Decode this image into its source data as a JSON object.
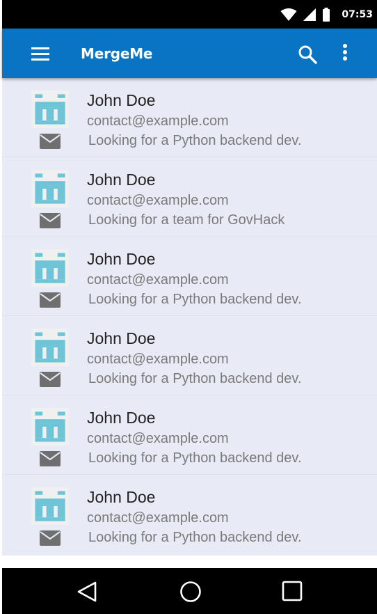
{
  "status_bar": {
    "time": "07:53",
    "icons": [
      "wifi-icon",
      "cellular-signal-icon",
      "battery-icon"
    ]
  },
  "app_bar": {
    "title": "MergeMe",
    "color": "#0a74c4",
    "icons": [
      "menu-icon",
      "search-icon",
      "more-vert-icon"
    ]
  },
  "list": {
    "background": "#e8eaf6",
    "items": [
      {
        "name": "John Doe",
        "email": "contact@example.com",
        "description": "Looking for a Python backend dev."
      },
      {
        "name": "John Doe",
        "email": "contact@example.com",
        "description": "Looking for a team for GovHack"
      },
      {
        "name": "John Doe",
        "email": "contact@example.com",
        "description": "Looking for a Python backend dev."
      },
      {
        "name": "John Doe",
        "email": "contact@example.com",
        "description": "Looking for a Python backend dev."
      },
      {
        "name": "John Doe",
        "email": "contact@example.com",
        "description": "Looking for a Python backend dev."
      },
      {
        "name": "John Doe",
        "email": "contact@example.com",
        "description": "Looking for a Python backend dev."
      }
    ]
  },
  "nav_bar": {
    "icons": [
      "back-icon",
      "home-icon",
      "recents-icon"
    ]
  }
}
